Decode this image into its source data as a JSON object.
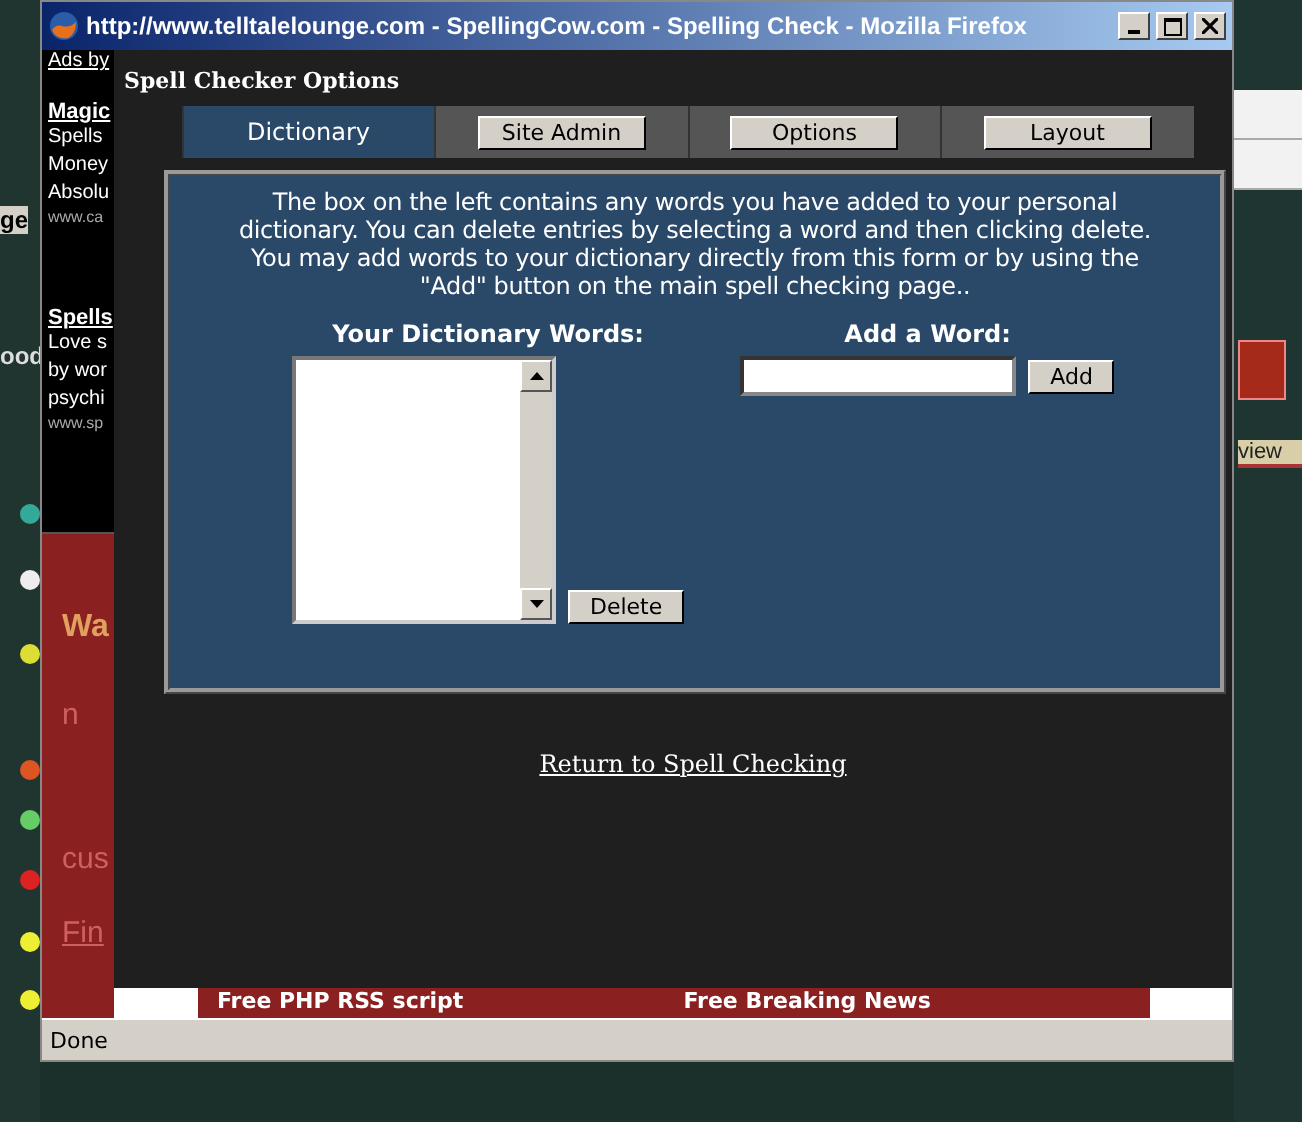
{
  "window": {
    "title": "http://www.telltalelounge.com - SpellingCow.com - Spelling Check - Mozilla Firefox"
  },
  "background_page": {
    "left_edge": [
      "ge",
      "ood"
    ],
    "right_edge": [
      "view"
    ],
    "ads": {
      "header": "Ads by",
      "blocks": [
        {
          "title": "Magic",
          "lines": [
            "Spells",
            "Money",
            "Absolu"
          ],
          "url": "www.ca"
        },
        {
          "title": "Spells",
          "lines": [
            "Love s",
            "by wor",
            "psychi"
          ],
          "url": "www.sp"
        }
      ]
    },
    "red_panel": [
      "Wa",
      "n",
      "cus",
      "Fin"
    ],
    "footer_links": [
      "Free PHP RSS script",
      "Free Breaking News"
    ]
  },
  "page_title": "Spell Checker Options",
  "tabs": [
    {
      "label": "Dictionary",
      "selected": true
    },
    {
      "label": "Site Admin",
      "selected": false
    },
    {
      "label": "Options",
      "selected": false
    },
    {
      "label": "Layout",
      "selected": false
    }
  ],
  "intro": "The box on the left contains any words you have added to your personal dictionary. You can delete entries by selecting a word and then clicking delete. You may add words to your dictionary directly from this form or by using the \"Add\" button on the main spell checking page..",
  "dictionary": {
    "label": "Your Dictionary Words:",
    "delete_button": "Delete"
  },
  "add_word": {
    "label": "Add a Word:",
    "button": "Add"
  },
  "return_link": "Return to Spell Checking",
  "status_bar": "Done"
}
